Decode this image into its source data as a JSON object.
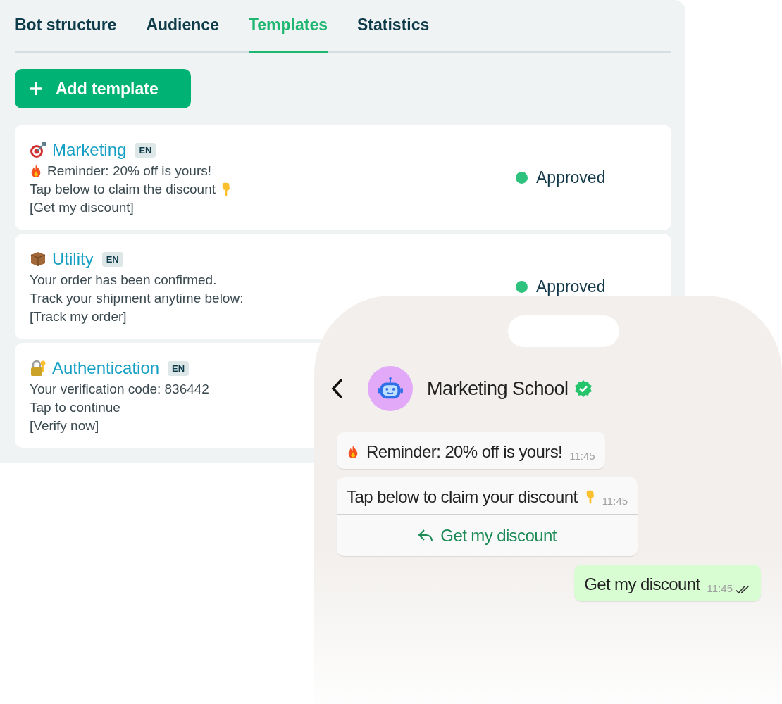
{
  "tabs": [
    {
      "label": "Bot structure",
      "selected": false
    },
    {
      "label": "Audience",
      "selected": false
    },
    {
      "label": "Templates",
      "selected": true
    },
    {
      "label": "Statistics",
      "selected": false
    }
  ],
  "add_button": {
    "label": "Add template"
  },
  "templates": [
    {
      "category": "Marketing",
      "language": "EN",
      "lines": [
        "Reminder: 20% off is yours!",
        "Tap below to claim the discount",
        "[Get my discount]"
      ],
      "status": "Approved"
    },
    {
      "category": "Utility",
      "language": "EN",
      "lines": [
        "Your order has been confirmed.",
        "Track your shipment anytime below:",
        "[Track my order]"
      ],
      "status": "Approved"
    },
    {
      "category": "Authentication",
      "language": "EN",
      "lines": [
        "Your verification code: 836442",
        "Tap to continue",
        "[Verify now]"
      ]
    }
  ],
  "chat": {
    "contact": {
      "name": "Marketing School",
      "verified": true
    },
    "messages": [
      {
        "kind": "incoming",
        "text": "Reminder: 20% off is yours!",
        "time": "11:45"
      },
      {
        "kind": "incoming",
        "text": "Tap below to claim your discount",
        "time": "11:45",
        "button": "Get my discount"
      },
      {
        "kind": "outgoing",
        "text": "Get my discount",
        "time": "11:45",
        "read": true
      }
    ]
  }
}
